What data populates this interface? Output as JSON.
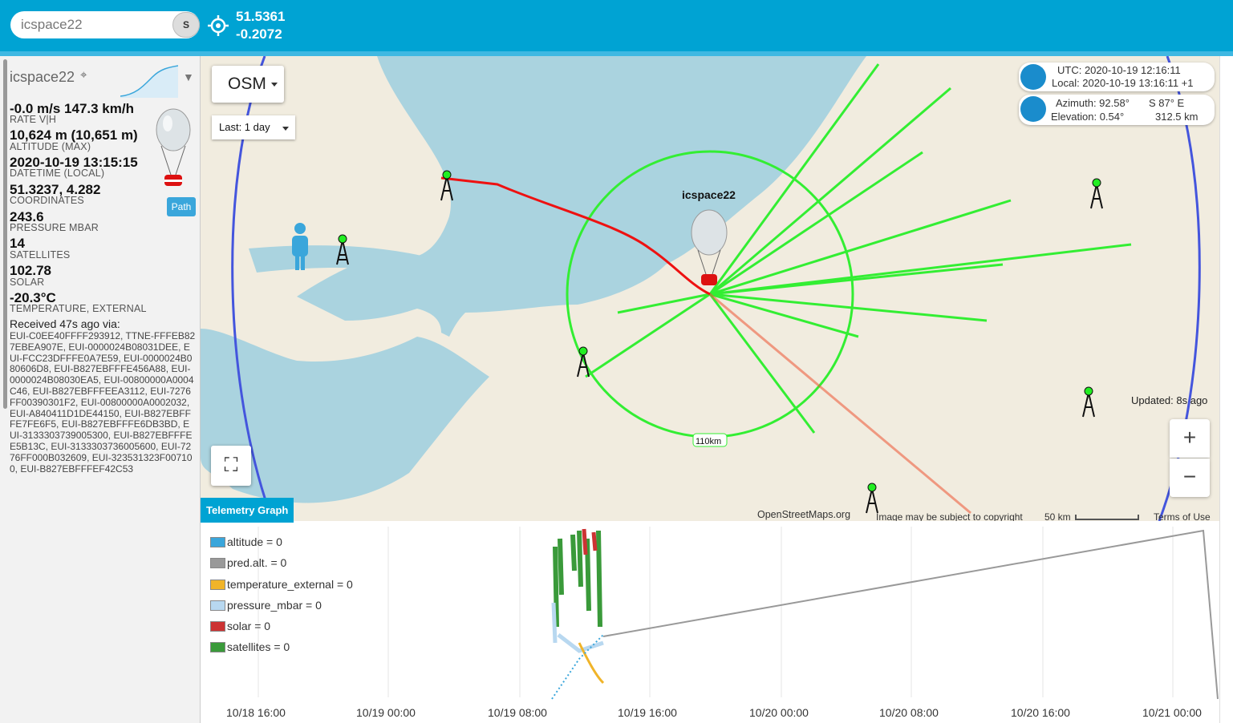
{
  "header": {
    "search_value": "icspace22",
    "search_button": "S",
    "lat": "51.5361",
    "lon": "-0.2072"
  },
  "sidebar": {
    "callsign": "icspace22",
    "toggle": "▼",
    "fields": [
      {
        "value": "-0.0 m/s 147.3 km/h",
        "label": "RATE V|H"
      },
      {
        "value": "10,624 m (10,651 m)",
        "label": "ALTITUDE (MAX)"
      },
      {
        "value": "2020-10-19 13:15:15",
        "label": "DATETIME (LOCAL)"
      },
      {
        "value": "51.3237, 4.282",
        "label": "COORDINATES"
      },
      {
        "value": "243.6",
        "label": "PRESSURE MBAR"
      },
      {
        "value": "14",
        "label": "SATELLITES"
      },
      {
        "value": "102.78",
        "label": "SOLAR"
      },
      {
        "value": "-20.3°C",
        "label": "TEMPERATURE, EXTERNAL"
      }
    ],
    "path_button": "Path",
    "received_header": "Received 47s ago via:",
    "received_list": "EUI-C0EE40FFFF293912, TTNE-FFFEB827EBEA907E, EUI-0000024B08031DEE, EUI-FCC23DFFFE0A7E59, EUI-0000024B080606D8, EUI-B827EBFFFE456A88, EUI-0000024B08030EA5, EUI-00800000A0004C46, EUI-B827EBFFFEEA3112, EUI-7276FF00390301F2, EUI-00800000A0002032, EUI-A840411D1DE44150, EUI-B827EBFFFE7FE6F5, EUI-B827EBFFFE6DB3BD, EUI-3133303739005300, EUI-B827EBFFFEE5B13C, EUI-3133303736005600, EUI-7276FF000B032609, EUI-323531323F007100, EUI-B827EBFFFEF42C53"
  },
  "map": {
    "layer": "OSM",
    "period": "Last: 1 day",
    "payload_label": "icspace22",
    "range_label": "110km",
    "utc": "UTC: 2020-10-19 12:16:11",
    "local": "Local: 2020-10-19 13:16:11 +1",
    "azimuth": "Azimuth: 92.58°",
    "direction": "S 87° E",
    "elevation": "Elevation: 0.54°",
    "distance": "312.5 km",
    "updated": "Updated: 8s ago",
    "zoom_in": "+",
    "zoom_out": "−",
    "attribution": "OpenStreetMaps.org",
    "copyright": "Image may be subject to copyright",
    "scale": "50 km",
    "terms": "Terms of Use",
    "colors": {
      "water": "#aad3df",
      "land": "#f1ecdf",
      "range": "#33ee33",
      "track": "#ee1111",
      "horizon": "#4455dd"
    }
  },
  "graph": {
    "tab": "Telemetry Graph",
    "legend": [
      {
        "label": "altitude = 0",
        "color": "#3aa6db"
      },
      {
        "label": "pred.alt. = 0",
        "color": "#999999"
      },
      {
        "label": "temperature_external = 0",
        "color": "#f0b429"
      },
      {
        "label": "pressure_mbar = 0",
        "color": "#b8d8f0"
      },
      {
        "label": "solar = 0",
        "color": "#cc3333"
      },
      {
        "label": "satellites = 0",
        "color": "#3a9a3a"
      }
    ],
    "x_ticks": [
      "10/18 16:00",
      "10/19 00:00",
      "10/19 08:00",
      "10/19 16:00",
      "10/20 00:00",
      "10/20 08:00",
      "10/20 16:00",
      "10/21 00:00"
    ]
  }
}
